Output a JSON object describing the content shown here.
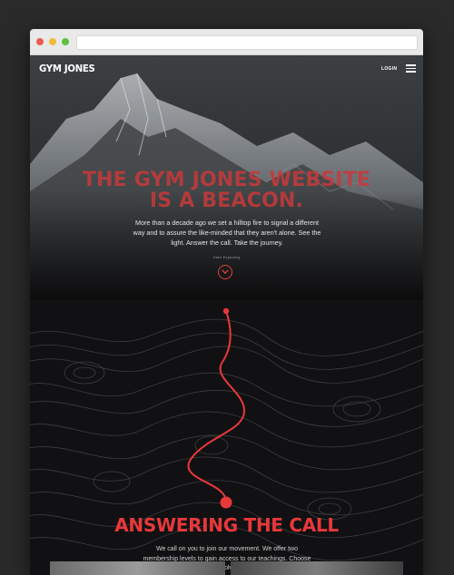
{
  "window": {
    "browser_dots": [
      "close",
      "minimize",
      "maximize"
    ]
  },
  "header": {
    "brand": "GYM JONES",
    "login_label": "LOGIN",
    "menu_icon": "hamburger-icon"
  },
  "hero": {
    "title_line1": "THE GYM JONES WEBSITE",
    "title_line2": "IS A BEACON.",
    "text": "More than a decade ago we set a hilltop fire to signal a different way and to assure the like-minded that they aren't alone. See the light. Answer the call. Take the journey.",
    "start_label": "Start Exploring",
    "scroll_icon": "chevron-down-icon"
  },
  "section": {
    "title": "ANSWERING THE CALL",
    "text": "We call on you to join our movement. We offer two membership levels to gain access to our teachings. Choose your involvement."
  },
  "colors": {
    "accent": "#e8383a",
    "background": "#0c0c0d"
  }
}
